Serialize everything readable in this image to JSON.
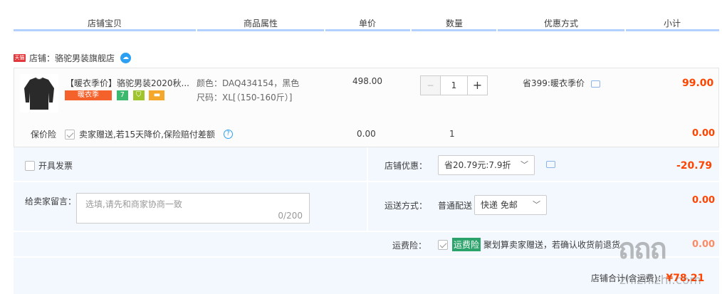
{
  "header": {
    "columns": [
      "店铺宝贝",
      "商品属性",
      "单价",
      "数量",
      "优惠方式",
      "小计"
    ]
  },
  "shop": {
    "badge": "天猫",
    "name": "店铺：骆驼男装旗舰店",
    "chat_icon": "wangwang-icon"
  },
  "item": {
    "title": "【暖衣季价】骆驼男装2020秋...",
    "tags": [
      {
        "text": "暖衣季",
        "color": "#f5612b"
      },
      {
        "text": "7",
        "color": "#3cb86f"
      },
      {
        "text": "",
        "color": "#a0c42c"
      },
      {
        "text": "",
        "color": "#f5a72b"
      }
    ],
    "color_attr": "颜色：DAQ434154，黑色",
    "size_attr": "尺码：XL[（150-160斤）]",
    "price": "498.00",
    "quantity": "1",
    "qty_minus": "−",
    "qty_plus": "+",
    "discount": "省399:暖衣季价",
    "subtotal": "99.00"
  },
  "insurance": {
    "label": "保价险",
    "desc": "卖家赠送,若15天降价,保险赔付差额",
    "price": "0.00",
    "quantity": "1",
    "subtotal": "0.00"
  },
  "invoice": {
    "label": "开具发票"
  },
  "shop_discount": {
    "label": "店铺优惠：",
    "selected": "省20.79元:7.9折",
    "amount": "-20.79"
  },
  "message": {
    "label": "给卖家留言：",
    "placeholder": "选填,请先和商家协商一致",
    "counter": "0/200"
  },
  "shipping": {
    "label": "运送方式：",
    "method": "普通配送",
    "selected": "快递 免邮",
    "amount": "0.00"
  },
  "freight_insurance": {
    "label": "运费险：",
    "badge": "运费险",
    "desc": "聚划算卖家赠送，若确认收货前退货",
    "amount": "0.00"
  },
  "total": {
    "label": "店铺合计(含运费)：",
    "amount": "¥78.21"
  },
  "watermark": {
    "text": "zhizhizhi.com"
  }
}
